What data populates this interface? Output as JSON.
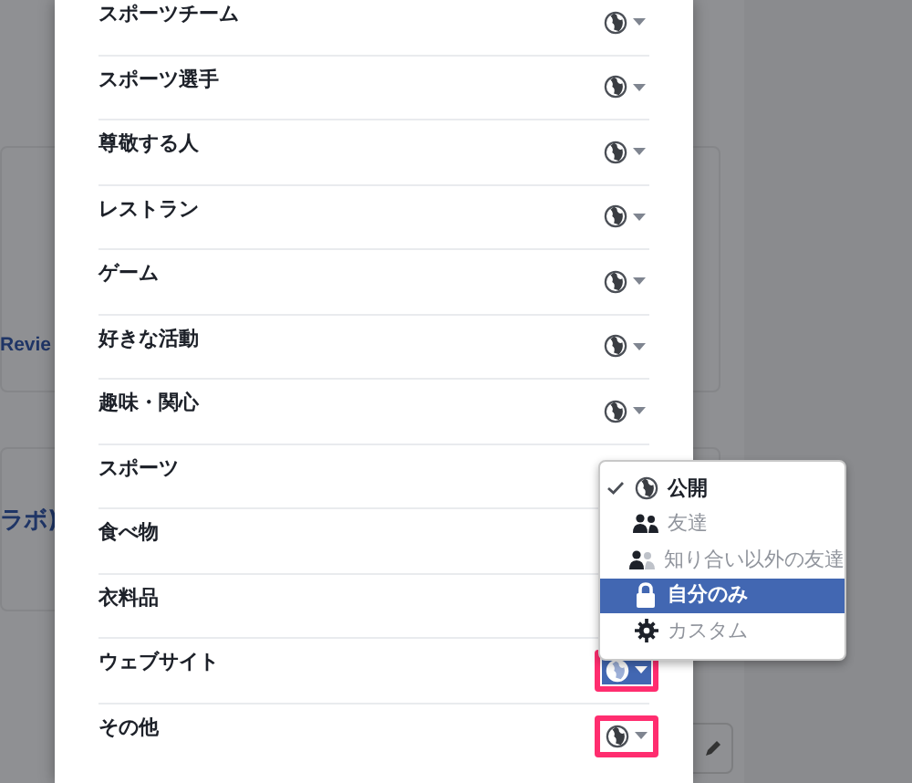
{
  "background": {
    "texts": [
      "Revie",
      "ラボ)"
    ]
  },
  "fields": [
    {
      "label": "スポーツチーム",
      "button": true,
      "active": false,
      "highlighted": false
    },
    {
      "label": "スポーツ選手",
      "button": true,
      "active": false,
      "highlighted": false
    },
    {
      "label": "尊敬する人",
      "button": true,
      "active": false,
      "highlighted": false
    },
    {
      "label": "レストラン",
      "button": true,
      "active": false,
      "highlighted": false
    },
    {
      "label": "ゲーム",
      "button": true,
      "active": false,
      "highlighted": false
    },
    {
      "label": "好きな活動",
      "button": true,
      "active": false,
      "highlighted": false
    },
    {
      "label": "趣味・関心",
      "button": true,
      "active": false,
      "highlighted": false
    },
    {
      "label": "スポーツ",
      "button": false
    },
    {
      "label": "食べ物",
      "button": false
    },
    {
      "label": "衣料品",
      "button": false
    },
    {
      "label": "ウェブサイト",
      "button": true,
      "active": true,
      "highlighted": true
    },
    {
      "label": "その他",
      "button": true,
      "active": false,
      "highlighted": true
    }
  ],
  "audience_menu": [
    {
      "kind": "globe",
      "label": "公開",
      "checked": true,
      "selected": false
    },
    {
      "kind": "friends",
      "label": "友達",
      "checked": false,
      "selected": false
    },
    {
      "kind": "friends-except",
      "label": "知り合い以外の友達",
      "checked": false,
      "selected": false
    },
    {
      "kind": "lock",
      "label": "自分のみ",
      "checked": false,
      "selected": true
    },
    {
      "kind": "gear",
      "label": "カスタム",
      "checked": false,
      "selected": false
    }
  ]
}
